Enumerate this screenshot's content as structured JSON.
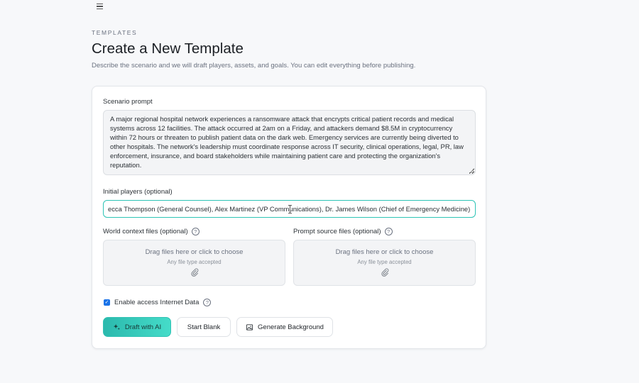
{
  "header": {
    "menu_icon": "hamburger-menu-icon",
    "eyebrow": "TEMPLATES",
    "title": "Create a New Template",
    "subtitle": "Describe the scenario and we will draft players, assets, and goals. You can edit everything before publishing."
  },
  "form": {
    "scenario_label": "Scenario prompt",
    "scenario_value": "A major regional hospital network experiences a ransomware attack that encrypts critical patient records and medical systems across 12 facilities. The attack occurred at 2am on a Friday, and attackers demand $8.5M in cryptocurrency within 72 hours or threaten to publish patient data on the dark web. Emergency services are currently being diverted to other hospitals. The network's leadership must coordinate response across IT security, clinical operations, legal, PR, law enforcement, insurance, and board stakeholders while maintaining patient care and protecting the organization's reputation.",
    "players_label": "Initial players (optional)",
    "players_value": "ecca Thompson (General Counsel), Alex Martinez (VP Communications), Dr. James Wilson (Chief of Emergency Medicine)",
    "world_files_label": "World context files (optional)",
    "prompt_files_label": "Prompt source files (optional)",
    "dropzone_main": "Drag files here or click to choose",
    "dropzone_sub": "Any file type accepted",
    "internet_label": "Enable access Internet Data",
    "internet_checked": true
  },
  "actions": {
    "draft_label": "Draft with AI",
    "blank_label": "Start Blank",
    "background_label": "Generate Background"
  },
  "colors": {
    "accent": "#2ec4b6",
    "checkbox": "#1a73e8"
  }
}
